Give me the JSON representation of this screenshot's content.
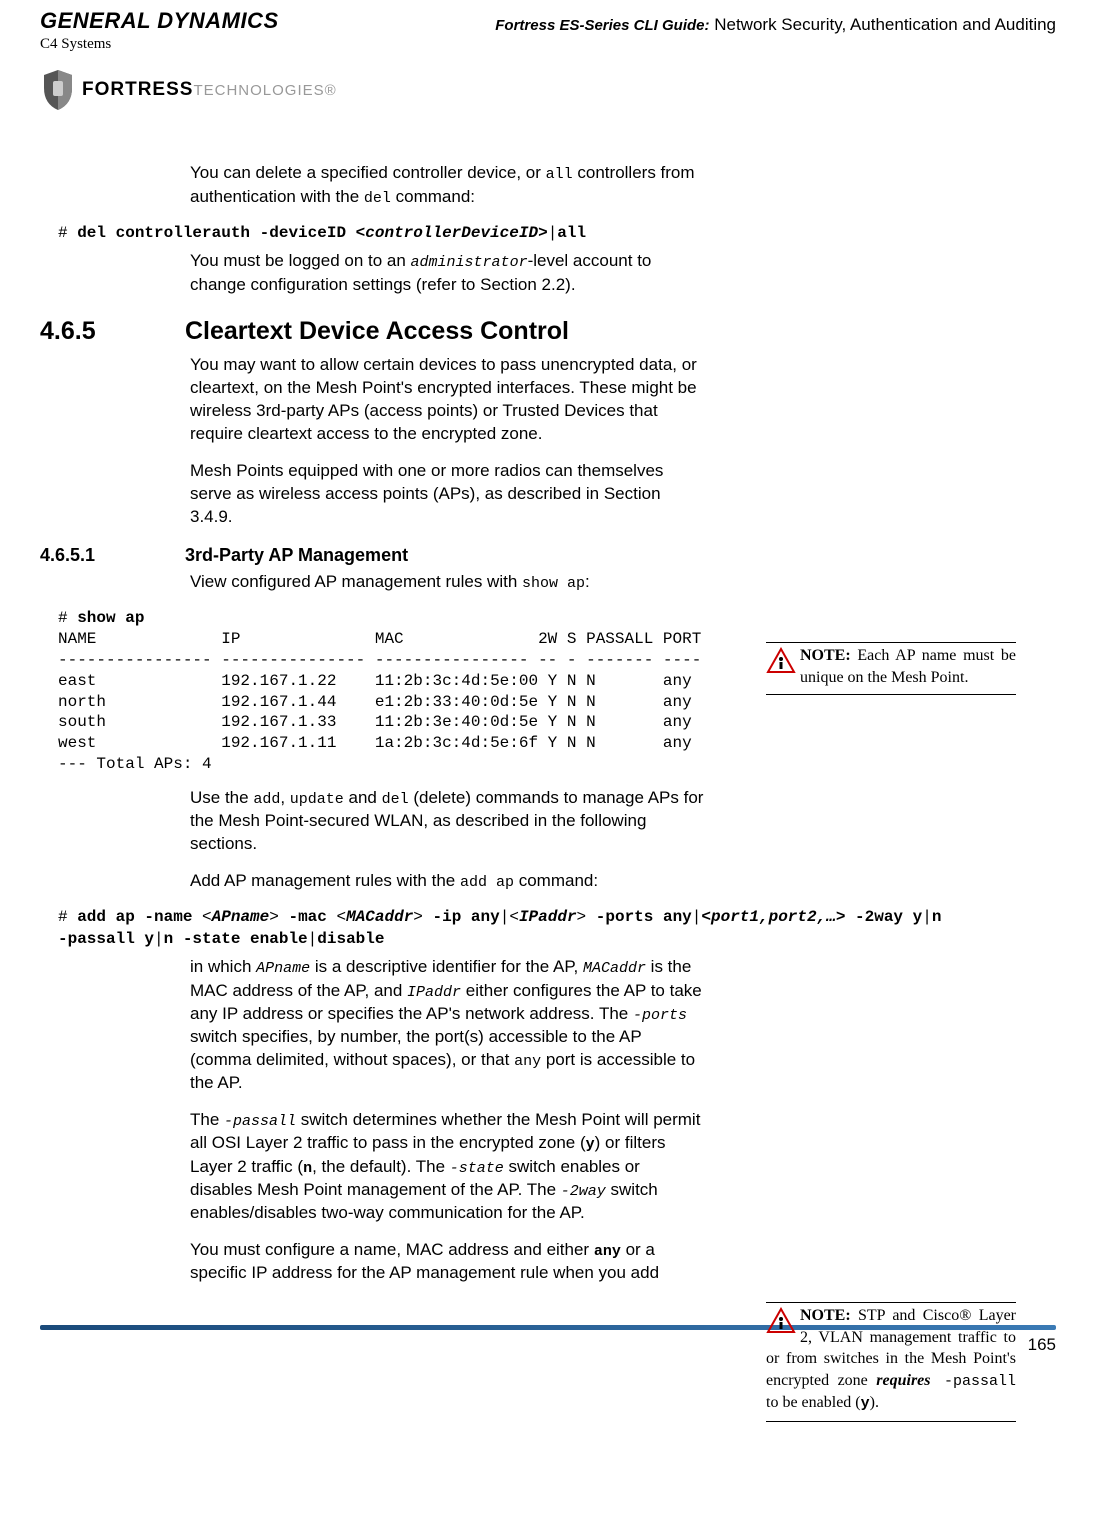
{
  "header": {
    "gd_logo": "GENERAL DYNAMICS",
    "c4": "C4 Systems",
    "fortress": "FORTRESS",
    "technologies": "TECHNOLOGIES",
    "guide_title_italic": "Fortress ES-Series CLI Guide:",
    "guide_title_rest": " Network Security, Authentication and Auditing"
  },
  "para_intro": {
    "t1": "You can delete a specified controller device, or ",
    "c1": "all",
    "t2": " controllers from authentication with the ",
    "c2": "del",
    "t3": " command:"
  },
  "cmd_del": {
    "prompt": "# ",
    "b1": "del controllerauth -deviceID ",
    "arg": "<controllerDeviceID>",
    "sep": "|",
    "b2": "all"
  },
  "para_admin": {
    "t1": "You must be logged on to an ",
    "c1": "administrator",
    "t2": "-level account to change configuration settings (refer to Section 2.2)."
  },
  "sec465": {
    "num": "4.6.5",
    "title": "Cleartext Device Access Control"
  },
  "para465a": "You may want to allow certain devices to pass unencrypted data, or cleartext, on the Mesh Point's encrypted interfaces. These might be wireless 3rd-party APs (access points) or Trusted Devices that require cleartext access to the encrypted zone.",
  "para465b": "Mesh Points equipped with one or more radios can themselves serve as wireless access points (APs), as described in Section 3.4.9.",
  "sec4651": {
    "num": "4.6.5.1",
    "title": "3rd-Party AP Management"
  },
  "para4651": {
    "t1": "View configured AP management rules with ",
    "c1": "show ap",
    "t2": ":"
  },
  "note1": {
    "label": "NOTE:",
    "text": " Each AP name must be unique on the Mesh Point."
  },
  "cli": {
    "prompt": "# ",
    "cmd": "show ap",
    "output": "NAME             IP              MAC              2W S PASSALL PORT\n---------------- --------------- ---------------- -- - ------- ----\neast             192.167.1.22    11:2b:3c:4d:5e:00 Y N N       any\nnorth            192.167.1.44    e1:2b:33:40:0d:5e Y N N       any\nsouth            192.167.1.33    11:2b:3e:40:0d:5e Y N N       any\nwest             192.167.1.11    1a:2b:3c:4d:5e:6f Y N N       any\n--- Total APs: 4"
  },
  "para_use": {
    "t1": "Use the ",
    "c1": "add",
    "t2": ", ",
    "c2": "update",
    "t3": " and ",
    "c3": "del",
    "t4": " (delete) commands to manage APs for the Mesh Point-secured WLAN, as described in the following sections."
  },
  "para_addap": {
    "t1": "Add AP management rules with the ",
    "c1": "add ap",
    "t2": " command:"
  },
  "cmd_addap": {
    "prompt": "# ",
    "p1": "add ap -name ",
    "a1": "<",
    "a1b": "APname",
    "a1c": ">",
    "p2": " -mac ",
    "a2": "<",
    "a2b": "MACaddr",
    "a2c": ">",
    "p3": " -ip any",
    "sep": "|",
    "a3": "<",
    "a3b": "IPaddr",
    "a3c": ">",
    "p4": " -ports any",
    "a4": "<port1,port2,…>",
    "p5": " -2way y",
    "p5b": "n ",
    "line2": "-passall y",
    "p6": "n -state enable",
    "p7": "disable"
  },
  "para_inwhich": {
    "t1": "in which ",
    "c1": "APname",
    "t2": " is a descriptive identifier for the AP, ",
    "c2": "MACaddr",
    "t3": " is the MAC address of the AP, and ",
    "c3": "IPaddr",
    "t4": " either configures the AP to take any IP address or specifies the AP's network address. The ",
    "c4": "-ports",
    "t5": " switch specifies, by number, the port(s) accessible to the AP (comma delimited, without spaces), or that ",
    "c5": "any",
    "t6": " port is accessible to the AP."
  },
  "para_passall": {
    "t1": "The ",
    "c1": "-passall",
    "t2": " switch determines whether the Mesh Point will permit all OSI Layer 2 traffic to pass in the encrypted zone (",
    "c2": "y",
    "t3": ") or filters Layer 2 traffic (",
    "c3": "n",
    "t4": ", the default). The ",
    "c4": "-state",
    "t5": " switch enables or disables Mesh Point management of the AP. The ",
    "c5": "-2way",
    "t6": " switch enables/disables two-way communication for the AP."
  },
  "note2": {
    "label": "NOTE:",
    "t1": " STP and Cisco® Layer 2, VLAN management traffic to or from switches in the Mesh Point's encrypted zone ",
    "req": "requires",
    "c1": " -passall",
    "t2": " to be enabled (",
    "c2": "y",
    "t3": ")."
  },
  "para_configure": {
    "t1": "You must configure a name, MAC address and either ",
    "c1": "any",
    "t2": " or a specific IP address for the AP management rule when you add"
  },
  "footer": {
    "page": "165"
  }
}
